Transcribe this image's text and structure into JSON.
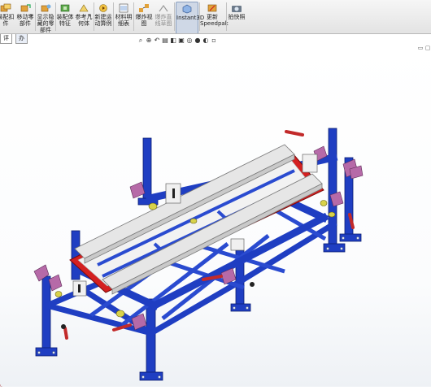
{
  "toolbar": {
    "buttons": [
      {
        "label": "装配扣\n件",
        "icon": "insert-component-icon"
      },
      {
        "label": "移动零\n部件",
        "icon": "move-component-icon"
      },
      {
        "label": "显示隐\n藏的零\n部件",
        "icon": "show-hidden-icon"
      },
      {
        "label": "装配体\n特征",
        "icon": "assembly-feature-icon"
      },
      {
        "label": "参考几\n何体",
        "icon": "reference-geometry-icon"
      },
      {
        "label": "新建运\n动算例",
        "icon": "motion-study-icon"
      },
      {
        "label": "材料明\n细表",
        "icon": "bom-icon"
      },
      {
        "label": "爆炸视\n图",
        "icon": "exploded-view-icon"
      },
      {
        "label": "爆炸直\n线草图",
        "icon": "explode-line-sketch-icon"
      },
      {
        "label": "Instant3D",
        "icon": "instant3d-icon"
      },
      {
        "label": "更新\nSpeedpak",
        "icon": "speedpak-icon"
      },
      {
        "label": "拍快照",
        "icon": "snapshot-icon"
      }
    ]
  },
  "tabs": [
    {
      "label": "评估"
    },
    {
      "label": "办公室产品"
    }
  ],
  "colors": {
    "frame_blue": "#1f3ec2",
    "plate_red": "#d42020",
    "bar_grey": "#e6e6e6",
    "clamp_purple": "#b66aa8",
    "pad_yellow": "#d8d24a"
  }
}
